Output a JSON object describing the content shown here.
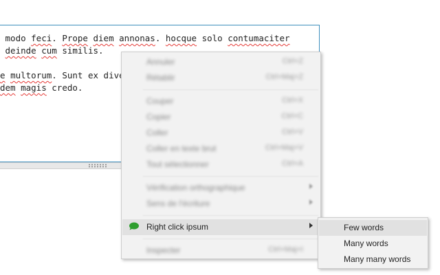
{
  "editor": {
    "lines": [
      [
        {
          "t": " modo "
        },
        {
          "t": "feci",
          "sp": true
        },
        {
          "t": ". "
        },
        {
          "t": "Prope",
          "sp": true
        },
        {
          "t": " "
        },
        {
          "t": "diem",
          "sp": true
        },
        {
          "t": " "
        },
        {
          "t": "annonas",
          "sp": true
        },
        {
          "t": ". "
        },
        {
          "t": "hocque",
          "sp": true
        },
        {
          "t": " solo "
        },
        {
          "t": "contumaciter",
          "sp": true
        }
      ],
      [
        {
          "t": " "
        },
        {
          "t": "deinde",
          "sp": true
        },
        {
          "t": " "
        },
        {
          "t": "cum",
          "sp": true
        },
        {
          "t": " similis."
        }
      ],
      [],
      [
        {
          "t": "e",
          "sp": true
        },
        {
          "t": " "
        },
        {
          "t": "multorum",
          "sp": true
        },
        {
          "t": ". Sunt ex dive"
        }
      ],
      [
        {
          "t": "dem",
          "sp": true
        },
        {
          "t": " "
        },
        {
          "t": "magis",
          "sp": true
        },
        {
          "t": " credo."
        }
      ]
    ]
  },
  "context_menu": {
    "items": [
      {
        "type": "item",
        "label": "Annuler",
        "shortcut": "Ctrl+Z"
      },
      {
        "type": "item",
        "label": "Rétablir",
        "shortcut": "Ctrl+Maj+Z"
      },
      {
        "type": "sep"
      },
      {
        "type": "item",
        "label": "Couper",
        "shortcut": "Ctrl+X"
      },
      {
        "type": "item",
        "label": "Copier",
        "shortcut": "Ctrl+C"
      },
      {
        "type": "item",
        "label": "Coller",
        "shortcut": "Ctrl+V"
      },
      {
        "type": "item",
        "label": "Coller en texte brut",
        "shortcut": "Ctrl+Maj+V"
      },
      {
        "type": "item",
        "label": "Tout sélectionner",
        "shortcut": "Ctrl+A"
      },
      {
        "type": "sep"
      },
      {
        "type": "item",
        "label": "Vérification orthographique",
        "submenu": true
      },
      {
        "type": "item",
        "label": "Sens de l'écriture",
        "submenu": true
      },
      {
        "type": "sep"
      },
      {
        "type": "item",
        "label": "Right click ipsum",
        "submenu": true,
        "active": true,
        "icon": "speech-bubble-icon"
      },
      {
        "type": "sep"
      },
      {
        "type": "item",
        "label": "Inspecter",
        "shortcut": "Ctrl+Maj+I"
      }
    ]
  },
  "submenu": {
    "items": [
      {
        "label": "Few words",
        "hover": true
      },
      {
        "label": "Many words"
      },
      {
        "label": "Many many words"
      }
    ]
  },
  "colors": {
    "accent_border": "#3c8dbc",
    "icon_green": "#2e9e2e",
    "menu_bg": "#f2f2f2",
    "menu_hover": "#e1e1e1",
    "spell_underline": "#e53935"
  }
}
